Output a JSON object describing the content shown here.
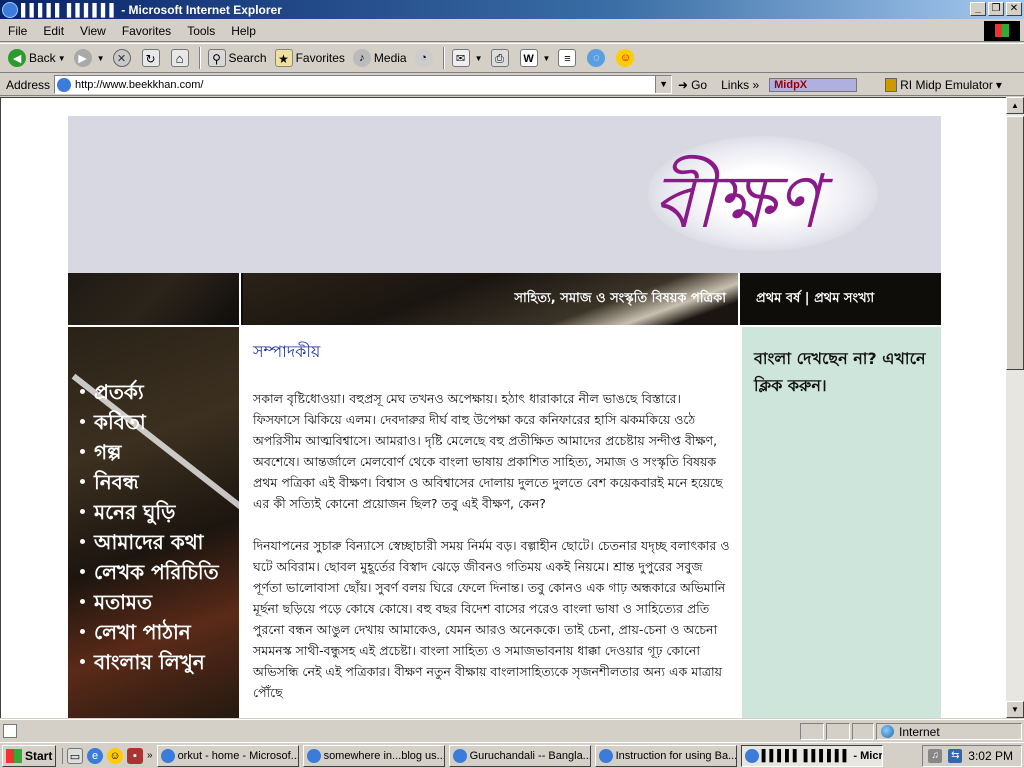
{
  "window": {
    "title": "▌▌▌▌▌ ▌▌▌▌▌▌ - Microsoft Internet Explorer"
  },
  "menubar": {
    "items": [
      "File",
      "Edit",
      "View",
      "Favorites",
      "Tools",
      "Help"
    ]
  },
  "toolbar": {
    "back_label": "Back",
    "search_label": "Search",
    "favorites_label": "Favorites",
    "media_label": "Media"
  },
  "addressbar": {
    "label": "Address",
    "url": "http://www.beekkhan.com/",
    "go_label": "Go",
    "links_label": "Links",
    "midp_label": "MidpX",
    "emulator_label": "RI Midp Emulator"
  },
  "page": {
    "logo_text": "বীক্ষণ",
    "tagline": "সাহিত্য, সমাজ ও সংস্কৃতি বিষয়ক পত্রিকা",
    "issue": "প্রথম বর্ষ | প্রথম সংখ্যা",
    "nav": [
      "প্রতর্ক্য",
      "কবিতা",
      "গল্প",
      "নিবন্ধ",
      "মনের ঘুড়ি",
      "আমাদের কথা",
      "লেখক পরিচিতি",
      "মতামত",
      "লেখা পাঠান",
      "বাংলায় লিখুন"
    ],
    "editorial_heading": "সম্পাদকীয়",
    "paragraph1": "সকাল বৃষ্টিধোওয়া। বহুপ্রসূ মেঘ তখনও অপেক্ষায়। হঠাৎ ধারাকারে নীল ভাঙছে বিস্তারে। ফিসফাসে ঝিকিয়ে এলম। দেবদারুর দীর্ঘ বাহু উপেক্ষা করে কনিফারের হাসি ঝকমকিয়ে ওঠে অপরিসীম আত্মবিশ্বাসে। আমরাও। দৃষ্টি মেলেছে বহু প্রতীক্ষিত আমাদের প্রচেষ্টায় সন্দীপ্ত বীক্ষণ, অবশেষে। আন্তর্জালে মেলবোর্ণ থেকে বাংলা ভাষায় প্রকাশিত সাহিত্য, সমাজ ও সংস্কৃতি বিষয়ক প্রথম পত্রিকা এই বীক্ষণ। বিশ্বাস ও অবিশ্বাসের দোলায় দুলতে দুলতে বেশ কয়েকবারই মনে হয়েছে এর কী সত্যিই কোনো প্রয়োজন ছিল? তবু এই বীক্ষণ, কেন?",
    "paragraph2": "দিনযাপনের সুচারু বিন্যাসে স্বেচ্ছাচারী সময় নির্মম বড়। বল্গাহীন ছোটে। চেতনার যদৃচ্ছ বলাৎকার ও ঘটে অবিরাম। ছোবল মুহূর্তের বিস্বাদ ঝেড়ে জীবনও গতিময় একই নিয়মে। শ্রান্ত দুপুরের সবুজ পূর্ণতা ভালোবাসা ছোঁয়। সুবর্ণ বলয় ঘিরে ফেলে দিনান্ত। তবু কোনও এক গাঢ় অন্ধকারে অভিমানি মূর্ছনা ছড়িয়ে পড়ে কোষে কোষে। বহু বছর বিদেশ বাসের পরেও বাংলা ভাষা ও সাহিত্যের প্রতি পুরনো বন্ধন আঙুল দেখায় আমাকেও, যেমন আরও অনেককে। তাই চেনা, প্রায়-চেনা ও অচেনা সমমনস্ক সাথী-বন্ধুসহ এই প্রচেষ্টা। বাংলা সাহিত্য ও সমাজভাবনায় ধাক্কা দেওয়ার গূঢ় কোনো অভিসন্ধি নেই এই পত্রিকার। বীক্ষণ নতুন বীক্ষায় বাংলাসাহিত্যকে সৃজনশীলতার অন্য এক মাত্রায় পৌঁছে",
    "notice": "বাংলা দেখছেন না? এখানে ক্লিক করুন।"
  },
  "statusbar": {
    "zone": "Internet"
  },
  "taskbar": {
    "start_label": "Start",
    "tasks": [
      "orkut - home - Microsof...",
      "somewhere in...blog us...",
      "Guruchandali -- Bangla...",
      "Instruction for using Ba...",
      "▌▌▌▌▌ ▌▌▌▌▌▌ - Micros..."
    ],
    "clock": "3:02 PM"
  }
}
